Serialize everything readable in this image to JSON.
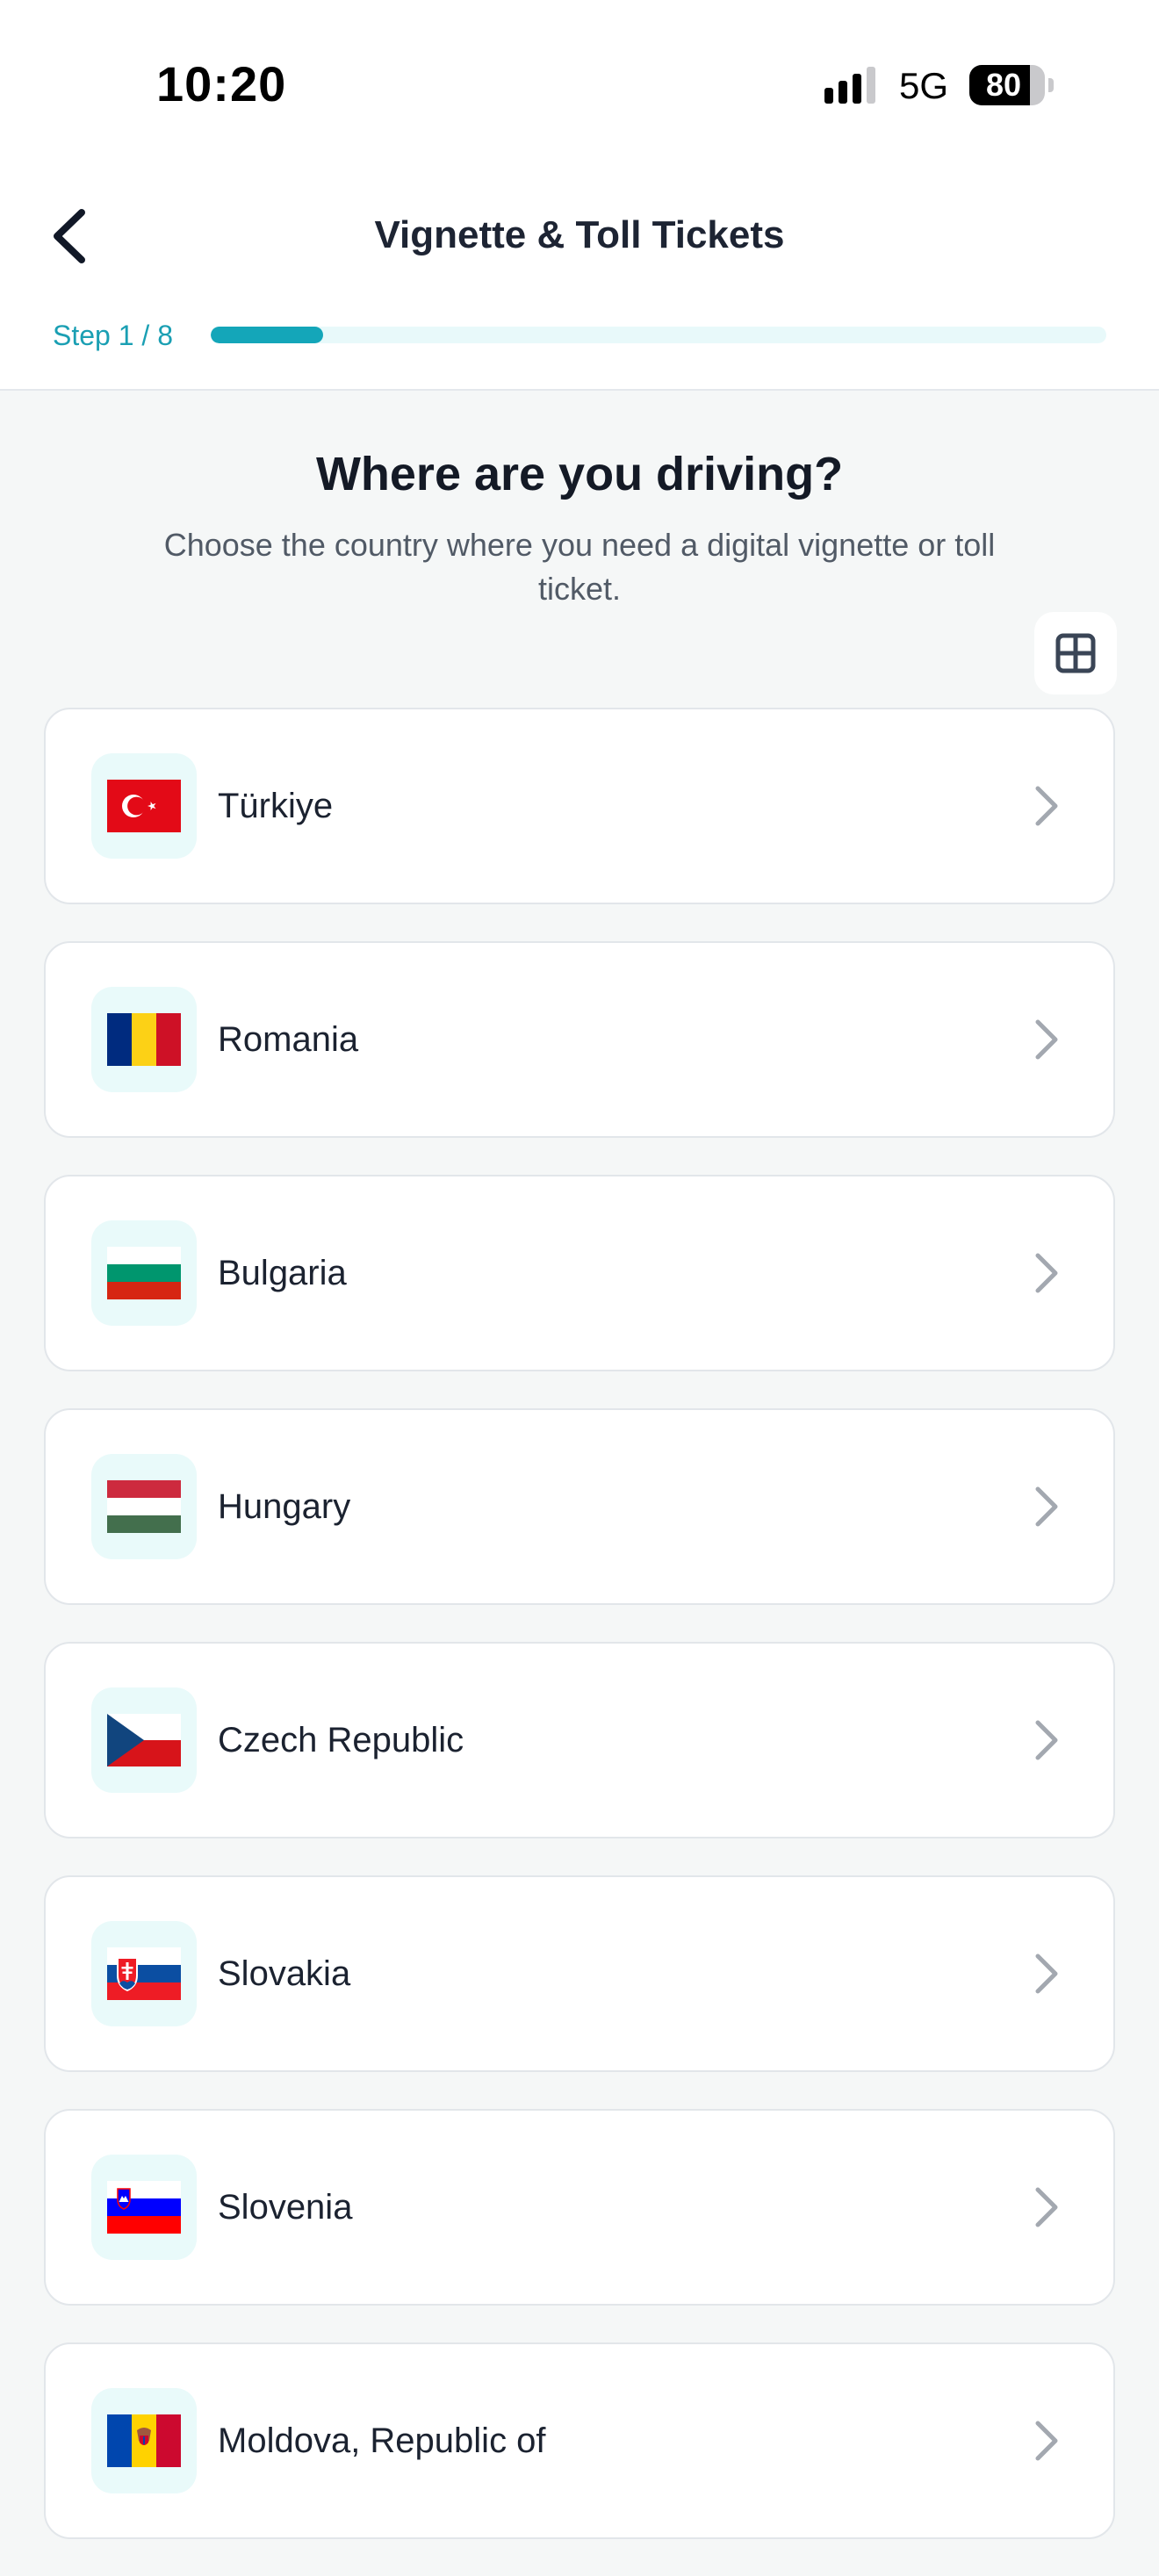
{
  "status_bar": {
    "time": "10:20",
    "network": "5G",
    "battery": "80",
    "battery_level": 0.8
  },
  "header": {
    "title": "Vignette & Toll Tickets",
    "back_icon": "chevron-left-icon"
  },
  "progress": {
    "label": "Step 1 / 8",
    "current": 1,
    "total": 8,
    "fraction": 0.125,
    "accent_color": "#14a6b9",
    "track_color": "#e8f9fa"
  },
  "main": {
    "heading": "Where are you driving?",
    "subheading": "Choose the country where you need a digital vignette or toll ticket.",
    "view_toggle_icon": "grid-icon"
  },
  "countries": [
    {
      "name": "Türkiye",
      "flag": "flag-turkey-icon"
    },
    {
      "name": "Romania",
      "flag": "flag-romania-icon"
    },
    {
      "name": "Bulgaria",
      "flag": "flag-bulgaria-icon"
    },
    {
      "name": "Hungary",
      "flag": "flag-hungary-icon"
    },
    {
      "name": "Czech Republic",
      "flag": "flag-czech-icon"
    },
    {
      "name": "Slovakia",
      "flag": "flag-slovakia-icon"
    },
    {
      "name": "Slovenia",
      "flag": "flag-slovenia-icon"
    },
    {
      "name": "Moldova, Republic of",
      "flag": "flag-moldova-icon"
    }
  ]
}
